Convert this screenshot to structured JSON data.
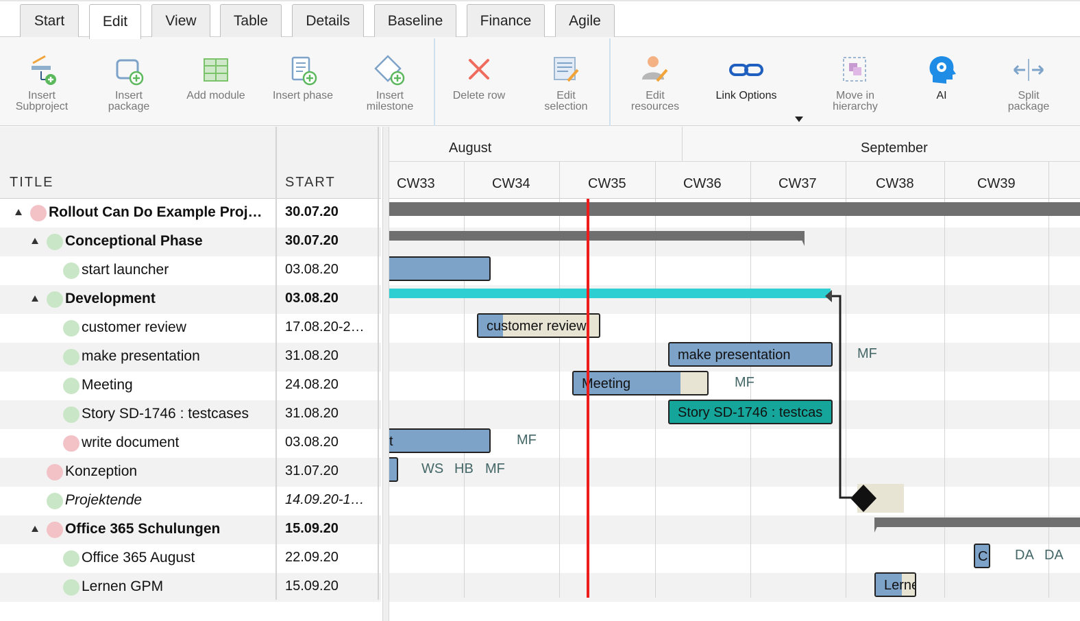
{
  "tabs": [
    "Start",
    "Edit",
    "View",
    "Table",
    "Details",
    "Baseline",
    "Finance",
    "Agile"
  ],
  "ribbon": {
    "insert_subproject": "Insert\nSubproject",
    "insert_package": "Insert\npackage",
    "add_module": "Add module",
    "insert_phase": "Insert phase",
    "insert_milestone": "Insert\nmilestone",
    "delete_row": "Delete row",
    "edit_selection": "Edit\nselection",
    "edit_resources": "Edit\nresources",
    "link_options": "Link Options",
    "move_in_hierarchy": "Move in\nhierarchy",
    "ai": "AI",
    "split_package": "Split\npackage"
  },
  "grid": {
    "col_title": "TITLE",
    "col_start": "START",
    "rows": [
      {
        "title": "Rollout Can Do Example Proj…",
        "start": "30.07.20"
      },
      {
        "title": "Conceptional Phase",
        "start": "30.07.20"
      },
      {
        "title": "start launcher",
        "start": "03.08.20"
      },
      {
        "title": "Development",
        "start": "03.08.20"
      },
      {
        "title": "customer review",
        "start": "17.08.20-2…"
      },
      {
        "title": "make presentation",
        "start": "31.08.20"
      },
      {
        "title": "Meeting",
        "start": "24.08.20"
      },
      {
        "title": "Story SD-1746 : testcases",
        "start": "31.08.20"
      },
      {
        "title": "write document",
        "start": "03.08.20"
      },
      {
        "title": "Konzeption",
        "start": "31.07.20"
      },
      {
        "title": "Projektende",
        "start": "14.09.20-1…"
      },
      {
        "title": "Office 365 Schulungen",
        "start": "15.09.20"
      },
      {
        "title": "Office 365 August",
        "start": "22.09.20"
      },
      {
        "title": "Lernen GPM",
        "start": "15.09.20"
      }
    ]
  },
  "gantt": {
    "months": [
      "August",
      "September"
    ],
    "weeks": [
      "CW33",
      "CW34",
      "CW35",
      "CW36",
      "CW37",
      "CW38",
      "CW39"
    ],
    "bars": {
      "customer_review": "customer review",
      "make_presentation": "make presentation",
      "meeting": "Meeting",
      "story": "Story SD-1746 : testcas",
      "write_document": "t",
      "office_august": "C",
      "lernen": "Lerne"
    },
    "resources": {
      "make_presentation": "MF",
      "meeting": "MF",
      "write_document": "MF",
      "konzeption": [
        "WS",
        "HB",
        "MF"
      ],
      "office_august": [
        "DA",
        "DA"
      ]
    },
    "colors": {
      "task_bar": "#7ea3c9",
      "progress_remaining": "#e8e4d4",
      "story_bar": "#16a59a",
      "phase_bar": "#2ecfd2",
      "summary_bar": "#6f6f6f",
      "today_line": "#ef1c1c",
      "status_green": "#c9e6c7",
      "status_red": "#f3c2c6"
    }
  }
}
